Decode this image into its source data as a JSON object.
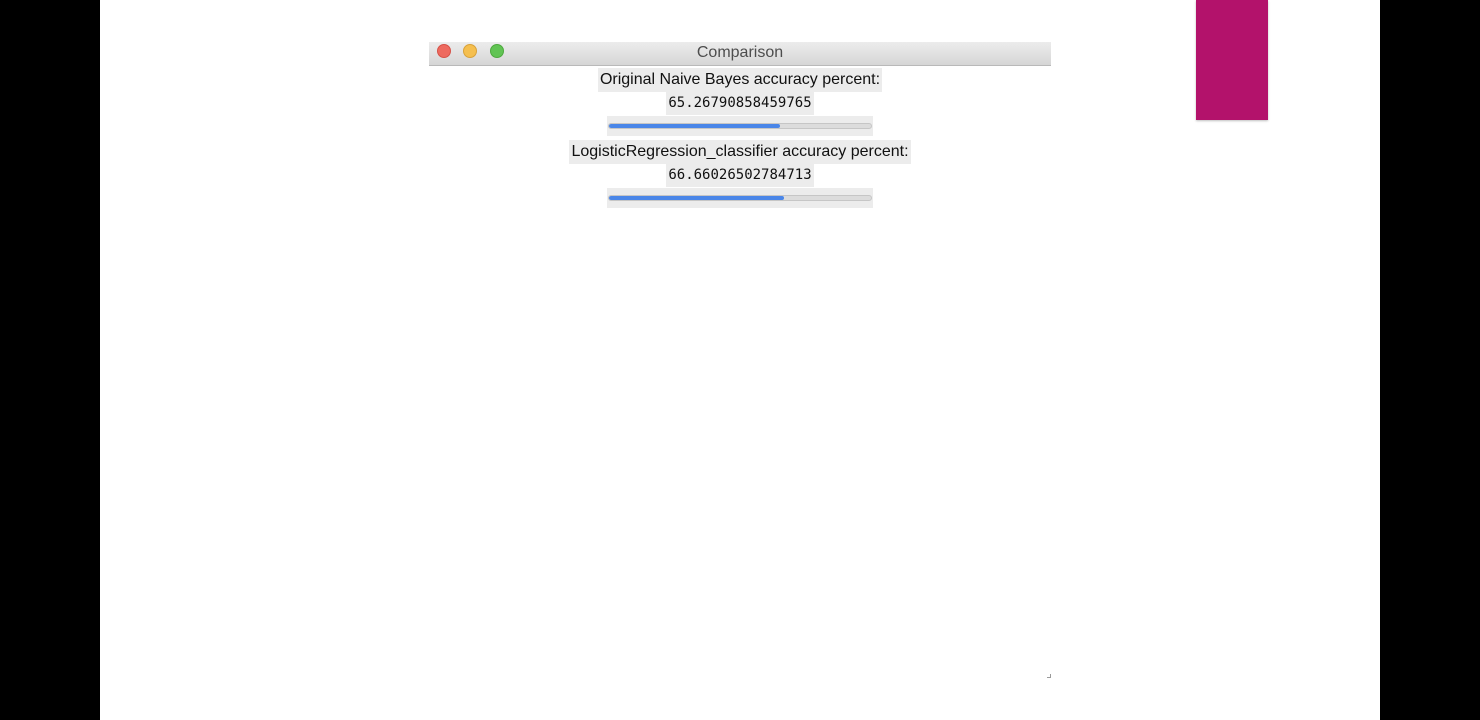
{
  "window": {
    "title": "Comparison"
  },
  "results": [
    {
      "label": "Original Naive Bayes accuracy percent:",
      "value": "65.26790858459765",
      "progress_percent": 65.26790858459765
    },
    {
      "label": "LogisticRegression_classifier accuracy percent:",
      "value": "66.66026502784713",
      "progress_percent": 66.66026502784713
    }
  ],
  "colors": {
    "accent": "#4a86e8",
    "side_block": "#b3126b",
    "close": "#ee6a5f",
    "minimize": "#f5bf4f",
    "zoom": "#61c454"
  },
  "icons": {
    "close": "close-icon",
    "minimize": "minimize-icon",
    "zoom": "zoom-icon",
    "resize": "resize-grip-icon"
  }
}
